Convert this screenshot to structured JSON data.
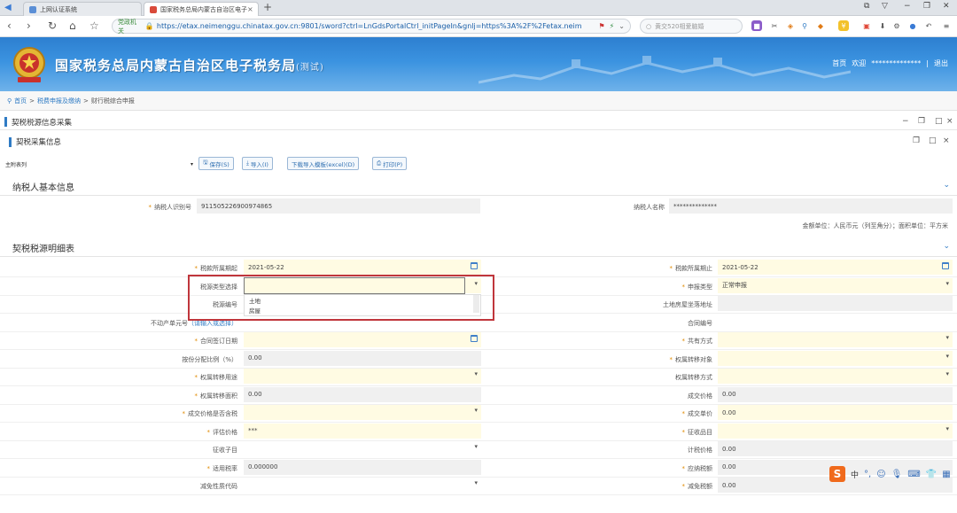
{
  "browser": {
    "tabs": [
      {
        "title": "上网认证系统",
        "state": "inactive"
      },
      {
        "title": "国家税务总局内蒙古自治区电子",
        "state": "active"
      }
    ],
    "new_tab": "+",
    "url_security_label": "党政机关",
    "url": "https://etax.neimenggu.chinatax.gov.cn:9801/sword?ctrl=LnGdsPortalCtrl_initPageIn&gnlj=https%3A%2F%2Fetax.neim",
    "search_placeholder": "黄交520相爱脑婚"
  },
  "site": {
    "title": "国家税务总局内蒙古自治区电子税务局",
    "title_suffix": "(测试)",
    "home_link": "首页",
    "welcome": "欢迎",
    "user_masked": "**************",
    "separator": "|",
    "logout": "退出"
  },
  "breadcrumb": {
    "items": [
      "首页",
      "税费申报及缴纳",
      "财行税综合申报"
    ],
    "sep": ">"
  },
  "outer_panel": {
    "title": "契税税源信息采集"
  },
  "inner_panel": {
    "title": "契税采集信息"
  },
  "toolbar": {
    "main_select": "主附表列",
    "buttons": [
      "保存(S)",
      "导入(I)",
      "下载导入模板(excel)(D)",
      "打印(P)"
    ]
  },
  "taxpayer_section": {
    "title": "纳税人基本信息",
    "id_label": "纳税人识别号",
    "id_value": "911505226900974865",
    "name_label": "纳税人名称",
    "name_value": "**************",
    "units_note": "金额单位：人民币元（列至角分）；面积单位：平方米"
  },
  "detail_section": {
    "title": "契税税源明细表",
    "left": [
      {
        "label": "税款所属期起",
        "value": "2021-05-22",
        "req": true,
        "style": "y",
        "icon": "calendar"
      },
      {
        "label": "税源类型选择",
        "value": "",
        "req": false,
        "style": "y",
        "icon": "caret"
      },
      {
        "label": "税源编号",
        "value": "",
        "req": false,
        "style": "w",
        "icon": ""
      },
      {
        "label": "不动产单元号",
        "hint": "（请输入或选择）",
        "value": "",
        "req": false,
        "style": "w",
        "icon": ""
      },
      {
        "label": "合同签订日期",
        "value": "",
        "req": true,
        "style": "y",
        "icon": "calendar"
      },
      {
        "label": "按份分配比例（%）",
        "value": "0.00",
        "req": false,
        "style": "g",
        "icon": ""
      },
      {
        "label": "权属转移用途",
        "value": "",
        "req": true,
        "style": "y",
        "icon": "caret"
      },
      {
        "label": "权属转移面积",
        "value": "0.00",
        "req": true,
        "style": "g",
        "icon": ""
      },
      {
        "label": "成交价格是否含税",
        "value": "",
        "req": true,
        "style": "y",
        "icon": "caret"
      },
      {
        "label": "评估价格",
        "value": "***",
        "req": true,
        "style": "y",
        "icon": ""
      },
      {
        "label": "征收子目",
        "value": "",
        "req": false,
        "style": "w",
        "icon": "caret"
      },
      {
        "label": "适用税率",
        "value": "0.000000",
        "req": true,
        "style": "g",
        "icon": ""
      },
      {
        "label": "减免性质代码",
        "value": "",
        "req": false,
        "style": "w",
        "icon": "caret"
      }
    ],
    "right": [
      {
        "label": "税款所属期止",
        "value": "2021-05-22",
        "req": true,
        "style": "y",
        "icon": "calendar"
      },
      {
        "label": "申报类型",
        "value": "正常申报",
        "req": true,
        "style": "y",
        "icon": "caret"
      },
      {
        "label": "土地房屋坐落地址",
        "value": "",
        "req": false,
        "style": "g",
        "icon": ""
      },
      {
        "label": "合同编号",
        "value": "",
        "req": false,
        "style": "w",
        "icon": ""
      },
      {
        "label": "共有方式",
        "value": "",
        "req": true,
        "style": "y",
        "icon": "caret"
      },
      {
        "label": "权属转移对象",
        "value": "",
        "req": true,
        "style": "y",
        "icon": "caret"
      },
      {
        "label": "权属转移方式",
        "value": "",
        "req": false,
        "style": "y",
        "icon": "caret"
      },
      {
        "label": "成交价格",
        "value": "0.00",
        "req": false,
        "style": "g",
        "icon": ""
      },
      {
        "label": "成交单价",
        "value": "0.00",
        "req": true,
        "style": "y",
        "icon": ""
      },
      {
        "label": "征收品目",
        "value": "",
        "req": true,
        "style": "y",
        "icon": "caret"
      },
      {
        "label": "计税价格",
        "value": "0.00",
        "req": false,
        "style": "g",
        "icon": ""
      },
      {
        "label": "应纳税额",
        "value": "0.00",
        "req": true,
        "style": "g",
        "icon": ""
      },
      {
        "label": "减免税额",
        "value": "0.00",
        "req": true,
        "style": "g",
        "icon": ""
      }
    ],
    "dropdown_options": [
      "土地",
      "房屋"
    ]
  },
  "ime": {
    "logo": "S",
    "lang": "中"
  },
  "colors": {
    "accent": "#2f7bc4",
    "required": "#e08a00",
    "highlight": "#c0363c",
    "field_yellow": "#fffbe3"
  }
}
